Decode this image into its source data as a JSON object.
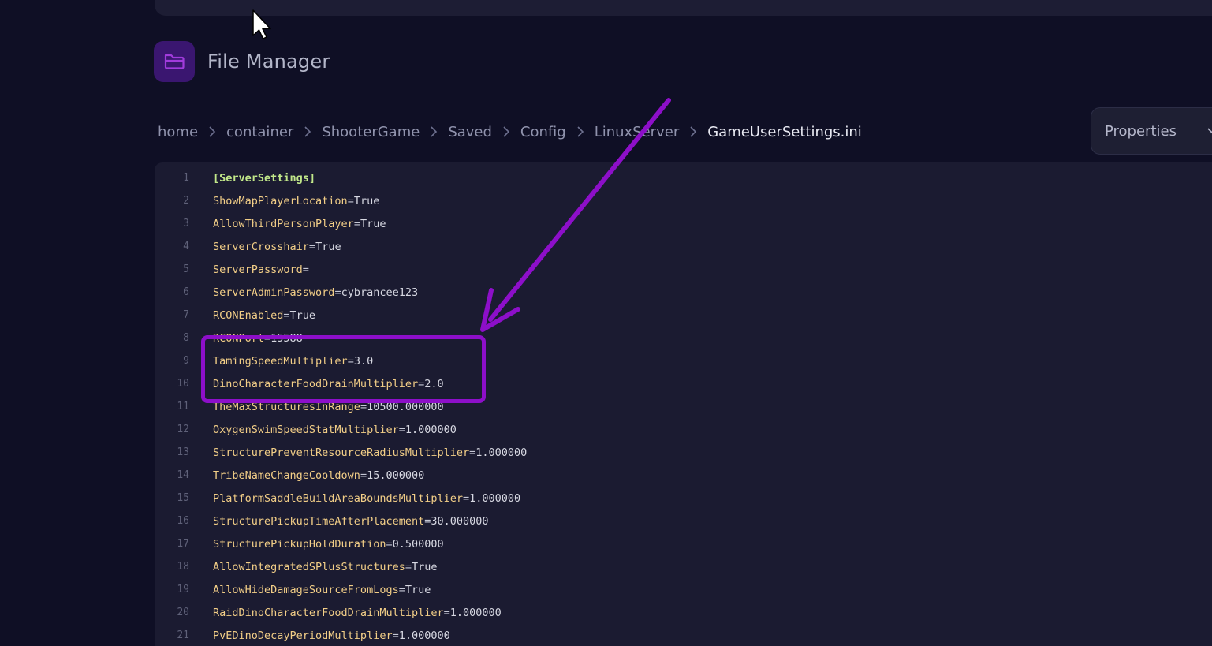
{
  "header": {
    "title": "File Manager",
    "icon": "folder-icon"
  },
  "breadcrumb": {
    "items": [
      "home",
      "container",
      "ShooterGame",
      "Saved",
      "Config",
      "LinuxServer",
      "GameUserSettings.ini"
    ]
  },
  "properties_button": {
    "label": "Properties"
  },
  "editor": {
    "lines": [
      {
        "num": "1",
        "section": "[ServerSettings]"
      },
      {
        "num": "2",
        "key": "ShowMapPlayerLocation",
        "eq": "=",
        "value": "True"
      },
      {
        "num": "3",
        "key": "AllowThirdPersonPlayer",
        "eq": "=",
        "value": "True"
      },
      {
        "num": "4",
        "key": "ServerCrosshair",
        "eq": "=",
        "value": "True"
      },
      {
        "num": "5",
        "key": "ServerPassword",
        "eq": "=",
        "value": ""
      },
      {
        "num": "6",
        "key": "ServerAdminPassword",
        "eq": "=",
        "value": "cybrancee123"
      },
      {
        "num": "7",
        "key": "RCONEnabled",
        "eq": "=",
        "value": "True"
      },
      {
        "num": "8",
        "key": "RCONPort",
        "eq": "=",
        "value": "15588"
      },
      {
        "num": "9",
        "key": "TamingSpeedMultiplier",
        "eq": "=",
        "value": "3.0"
      },
      {
        "num": "10",
        "key": "DinoCharacterFoodDrainMultiplier",
        "eq": "=",
        "value": "2.0"
      },
      {
        "num": "11",
        "key": "TheMaxStructuresInRange",
        "eq": "=",
        "value": "10500.000000"
      },
      {
        "num": "12",
        "key": "OxygenSwimSpeedStatMultiplier",
        "eq": "=",
        "value": "1.000000"
      },
      {
        "num": "13",
        "key": "StructurePreventResourceRadiusMultiplier",
        "eq": "=",
        "value": "1.000000"
      },
      {
        "num": "14",
        "key": "TribeNameChangeCooldown",
        "eq": "=",
        "value": "15.000000"
      },
      {
        "num": "15",
        "key": "PlatformSaddleBuildAreaBoundsMultiplier",
        "eq": "=",
        "value": "1.000000"
      },
      {
        "num": "16",
        "key": "StructurePickupTimeAfterPlacement",
        "eq": "=",
        "value": "30.000000"
      },
      {
        "num": "17",
        "key": "StructurePickupHoldDuration",
        "eq": "=",
        "value": "0.500000"
      },
      {
        "num": "18",
        "key": "AllowIntegratedSPlusStructures",
        "eq": "=",
        "value": "True"
      },
      {
        "num": "19",
        "key": "AllowHideDamageSourceFromLogs",
        "eq": "=",
        "value": "True"
      },
      {
        "num": "20",
        "key": "RaidDinoCharacterFoodDrainMultiplier",
        "eq": "=",
        "value": "1.000000"
      },
      {
        "num": "21",
        "key": "PvEDinoDecayPeriodMultiplier",
        "eq": "=",
        "value": "1.000000"
      }
    ]
  },
  "colors": {
    "accent": "#8d0fc9",
    "section": "#c2e88a",
    "key": "#f2ce87",
    "background": "#0f0f25",
    "editor_background": "#1b1b31"
  }
}
